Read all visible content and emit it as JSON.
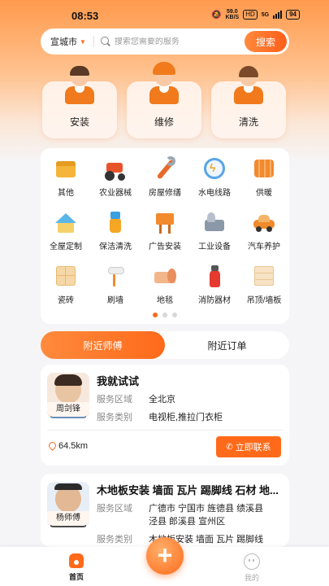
{
  "status_bar": {
    "time": "08:53",
    "speed": "59.0",
    "speed_unit": "KB/S",
    "hd": "HD",
    "network": "5G",
    "battery": "94"
  },
  "search": {
    "city": "宣城市",
    "placeholder": "搜索您需要的服务",
    "button": "搜索"
  },
  "services": [
    {
      "label": "安装",
      "icon": "installer-worker-icon"
    },
    {
      "label": "维修",
      "icon": "repair-worker-icon"
    },
    {
      "label": "清洗",
      "icon": "cleaning-worker-icon"
    }
  ],
  "categories": [
    {
      "label": "其他",
      "icon": "box-icon"
    },
    {
      "label": "农业器械",
      "icon": "tractor-icon"
    },
    {
      "label": "房屋修缮",
      "icon": "wrench-icon"
    },
    {
      "label": "水电线路",
      "icon": "lightning-icon"
    },
    {
      "label": "供暖",
      "icon": "radiator-icon"
    },
    {
      "label": "全屋定制",
      "icon": "house-icon"
    },
    {
      "label": "保洁清洗",
      "icon": "spray-bottle-icon"
    },
    {
      "label": "广告安装",
      "icon": "billboard-icon"
    },
    {
      "label": "工业设备",
      "icon": "machine-icon"
    },
    {
      "label": "汽车养护",
      "icon": "car-icon"
    },
    {
      "label": "瓷砖",
      "icon": "tile-icon"
    },
    {
      "label": "刷墙",
      "icon": "paint-roller-icon"
    },
    {
      "label": "地毯",
      "icon": "carpet-icon"
    },
    {
      "label": "消防器材",
      "icon": "fire-extinguisher-icon"
    },
    {
      "label": "吊顶/墙板",
      "icon": "ceiling-panel-icon"
    }
  ],
  "pager": {
    "pages": 3,
    "current": 1
  },
  "tabs": [
    "附近师傅",
    "附近订单"
  ],
  "masters": [
    {
      "name": "周剑锋",
      "title": "我就试试",
      "area_label": "服务区域",
      "area": "全北京",
      "type_label": "服务类别",
      "types": "电视柜,推拉门衣柜",
      "distance": "64.5km",
      "contact": "立即联系"
    },
    {
      "name": "杨师傅",
      "title": "木地板安装 墙面 瓦片 踢脚线 石材 地...",
      "area_label": "服务区域",
      "area_line1": "广德市 宁国市 旌德县 绩溪县",
      "area_line2": "泾县 郎溪县 宣州区",
      "type_label": "服务类别",
      "types": "木地板安装 墙面 瓦片 踢脚线"
    }
  ],
  "bottom_nav": {
    "home": "首页",
    "mine": "我的",
    "plus": "+"
  },
  "colors": {
    "accent": "#ff6a1a",
    "bg": "#f5f5f7"
  }
}
